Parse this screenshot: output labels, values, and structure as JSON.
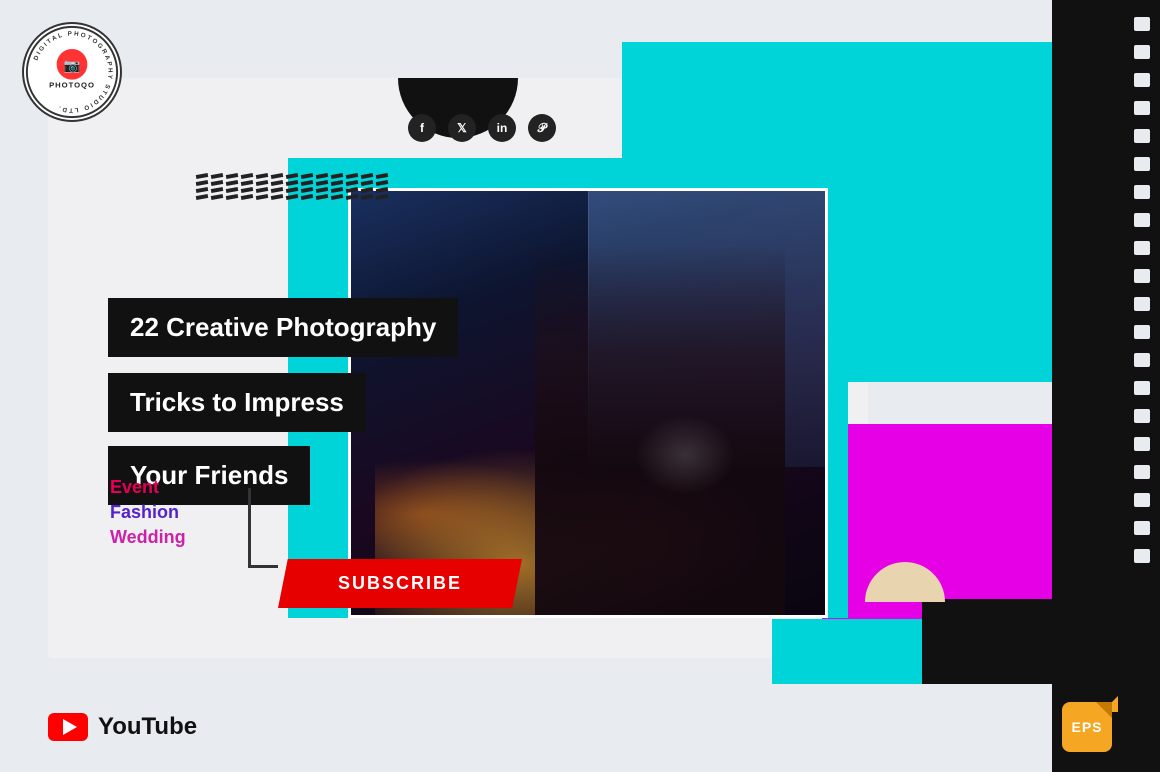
{
  "page": {
    "background": "#e8ecf0"
  },
  "logo": {
    "name": "PHOTOQO",
    "circle_text": "DIGITAL PHOTOGRAPHY STUDIO LTD.",
    "icon": "📷"
  },
  "social": {
    "icons": [
      "f",
      "t",
      "in",
      "p"
    ]
  },
  "title": {
    "line1": "22 Creative Photography",
    "line2": "Tricks to Impress",
    "line3": "Your Friends"
  },
  "categories": {
    "item1": "Event",
    "item2": "Fashion",
    "item3": "Wedding"
  },
  "subscribe_btn": "SUBSCRIBE",
  "bottom": {
    "youtube_label": "YouTube",
    "eps_label": "EPS"
  }
}
